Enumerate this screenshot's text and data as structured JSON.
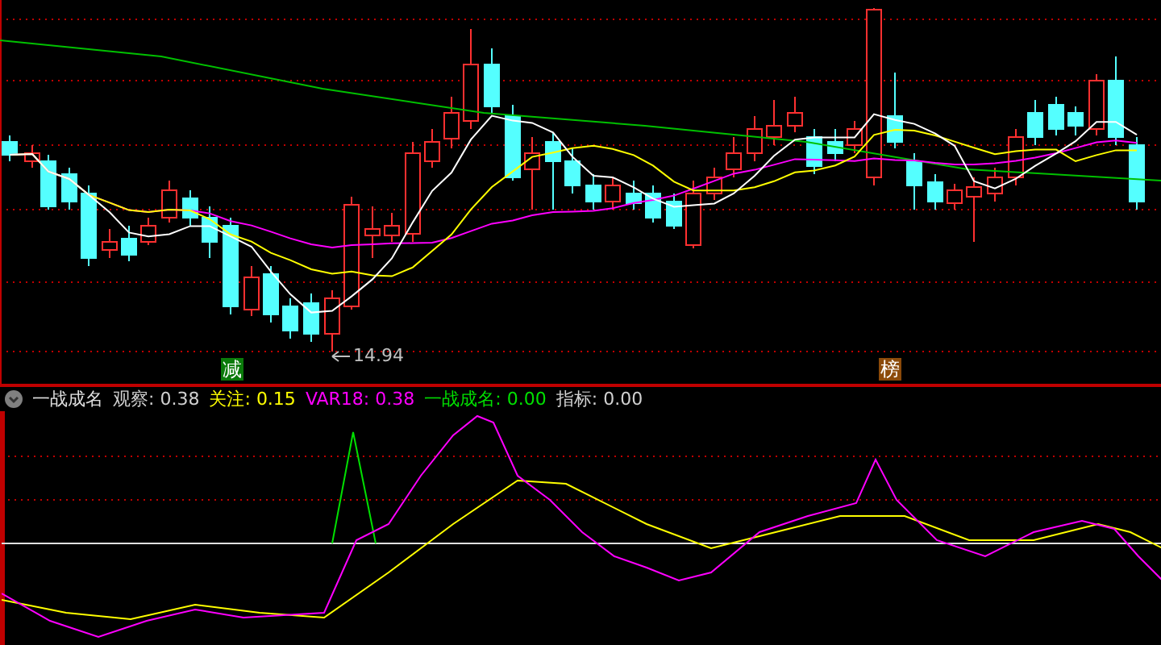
{
  "price_chart": {
    "low_label": "14.94",
    "signals": [
      {
        "label": "减",
        "color": "#0a7a0a"
      },
      {
        "label": "榜",
        "color": "#8b4a0a"
      }
    ]
  },
  "indicator": {
    "name": "一战成名",
    "values": [
      {
        "label": "观察:",
        "value": "0.38",
        "color": "#d0d0d0"
      },
      {
        "label": "关注:",
        "value": "0.15",
        "color": "#ffff00"
      },
      {
        "label": "VAR18:",
        "value": "0.38",
        "color": "#ff00ff"
      },
      {
        "label": "一战成名:",
        "value": "0.00",
        "color": "#00e000"
      },
      {
        "label": "指标:",
        "value": "0.00",
        "color": "#d0d0d0"
      }
    ]
  }
}
